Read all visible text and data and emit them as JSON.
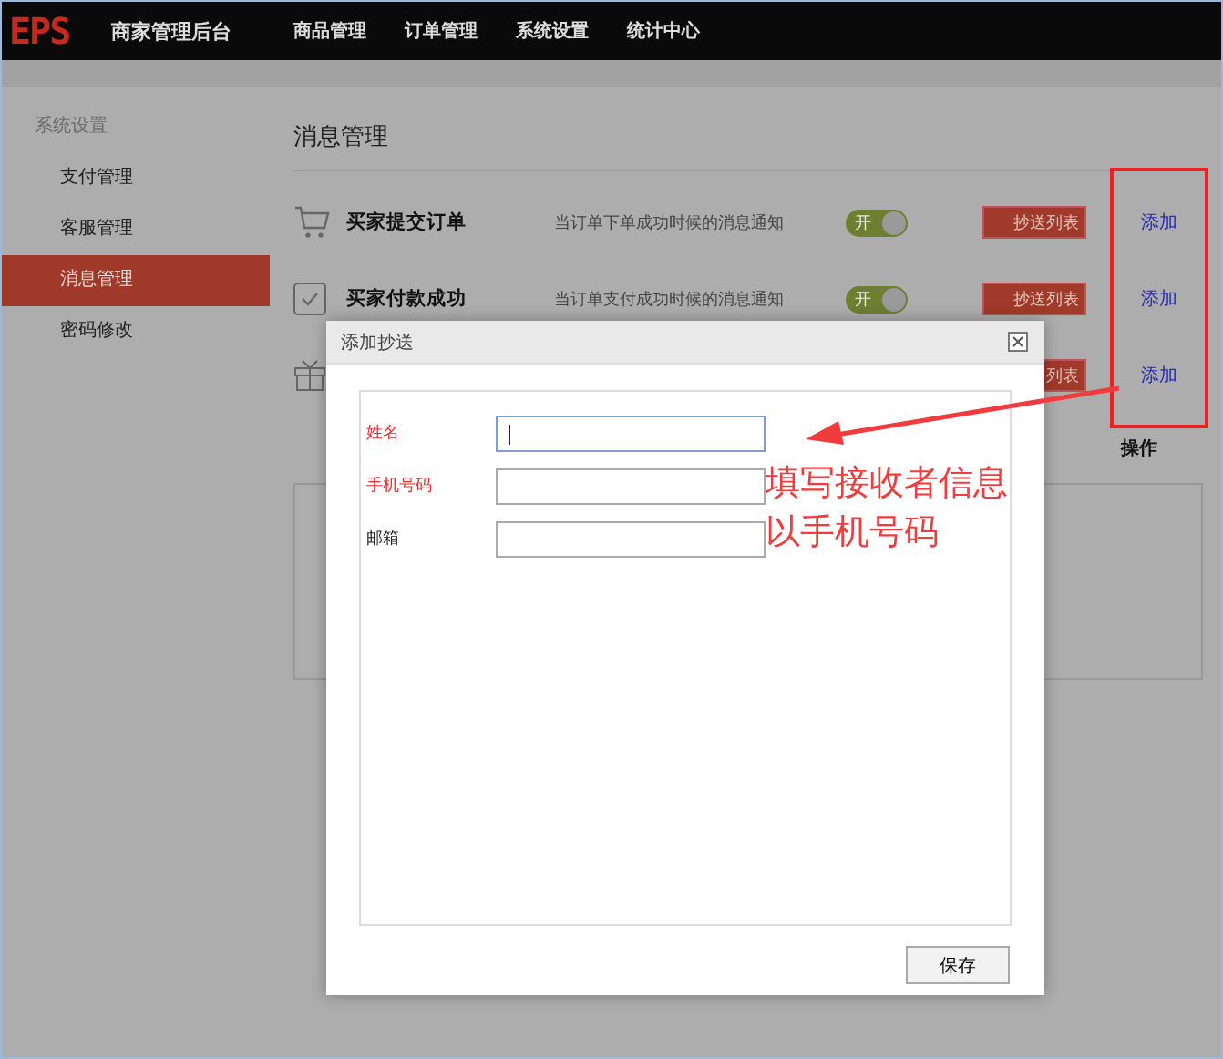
{
  "header": {
    "logo": "EPS",
    "title": "商家管理后台",
    "nav": [
      {
        "label": "商品管理"
      },
      {
        "label": "订单管理"
      },
      {
        "label": "系统设置"
      },
      {
        "label": "统计中心"
      }
    ]
  },
  "sidebar": {
    "heading": "系统设置",
    "items": [
      {
        "label": "支付管理",
        "selected": false
      },
      {
        "label": "客服管理",
        "selected": false
      },
      {
        "label": "消息管理",
        "selected": true
      },
      {
        "label": "密码修改",
        "selected": false
      }
    ]
  },
  "page_title": "消息管理",
  "rows": [
    {
      "kind": "cart",
      "name": "买家提交订单",
      "description": "当订单下单成功时候的消息通知",
      "toggle": {
        "label": "开",
        "on": true
      },
      "list_button": "抄送列表",
      "add_link": "添加"
    },
    {
      "kind": "check",
      "name": "买家付款成功",
      "description": "当订单支付成功时候的消息通知",
      "toggle": {
        "label": "开",
        "on": true
      },
      "list_button": "抄送列表",
      "add_link": "添加"
    },
    {
      "kind": "gift",
      "list_button": "列表",
      "add_link": "添加"
    }
  ],
  "column_header": "操作",
  "dialog": {
    "title": "添加抄送",
    "fields": [
      {
        "label": "姓名",
        "required": true,
        "focused": true
      },
      {
        "label": "手机号码",
        "required": true,
        "focused": false
      },
      {
        "label": "邮箱",
        "required": false,
        "focused": false
      }
    ],
    "save_button": "保存"
  },
  "annotation": {
    "lines": [
      "填写接收者信息",
      "以手机号码"
    ]
  }
}
